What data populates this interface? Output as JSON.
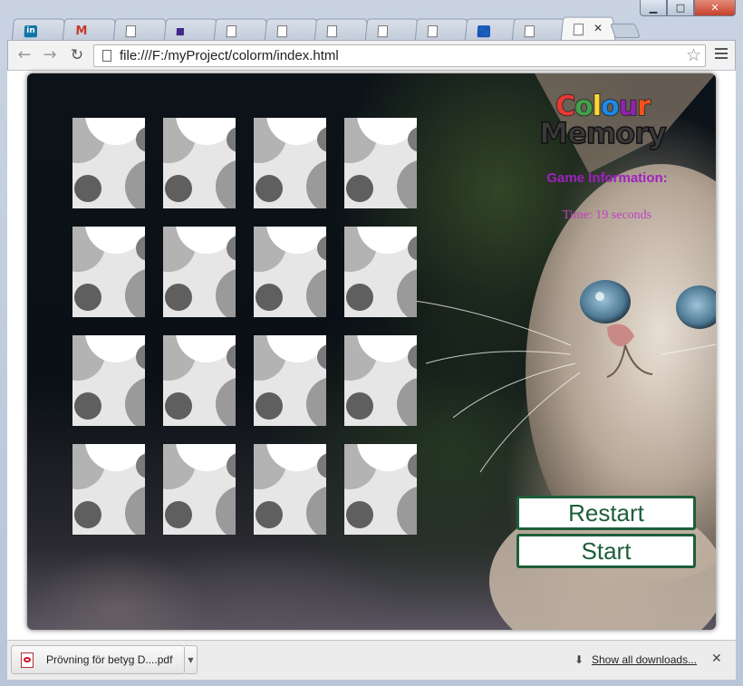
{
  "browser": {
    "url": "file:///F:/myProject/colorm/index.html",
    "tabs": [
      {
        "icon": "linkedin-icon",
        "glyph": "in"
      },
      {
        "icon": "gmail-icon",
        "glyph": "M"
      },
      {
        "icon": "page-icon",
        "glyph": ""
      },
      {
        "icon": "square-icon",
        "glyph": ""
      },
      {
        "icon": "page-icon",
        "glyph": ""
      },
      {
        "icon": "page-icon",
        "glyph": ""
      },
      {
        "icon": "page-icon",
        "glyph": ""
      },
      {
        "icon": "page-icon",
        "glyph": ""
      },
      {
        "icon": "page-icon",
        "glyph": ""
      },
      {
        "icon": "paw-icon",
        "glyph": "🐾"
      },
      {
        "icon": "page-icon",
        "glyph": ""
      },
      {
        "icon": "page-icon",
        "glyph": "",
        "active": true
      }
    ]
  },
  "game": {
    "logo": {
      "line1": [
        "C",
        "o",
        "l",
        "o",
        "u",
        "r"
      ],
      "line1_colors": [
        "#e53935",
        "#43a047",
        "#fdd835",
        "#1e88e5",
        "#8e24aa",
        "#f4511e"
      ],
      "line2": "Memory"
    },
    "info_title": "Game Information:",
    "time_text": "Time: 19 seconds",
    "restart_label": "Restart",
    "start_label": "Start",
    "card_count": 16
  },
  "downloads": {
    "file_name": "Prövning för betyg D....pdf",
    "show_all": "Show all downloads..."
  },
  "colors": {
    "button_green": "#1e5e3a",
    "info_purple": "#a020c0"
  }
}
